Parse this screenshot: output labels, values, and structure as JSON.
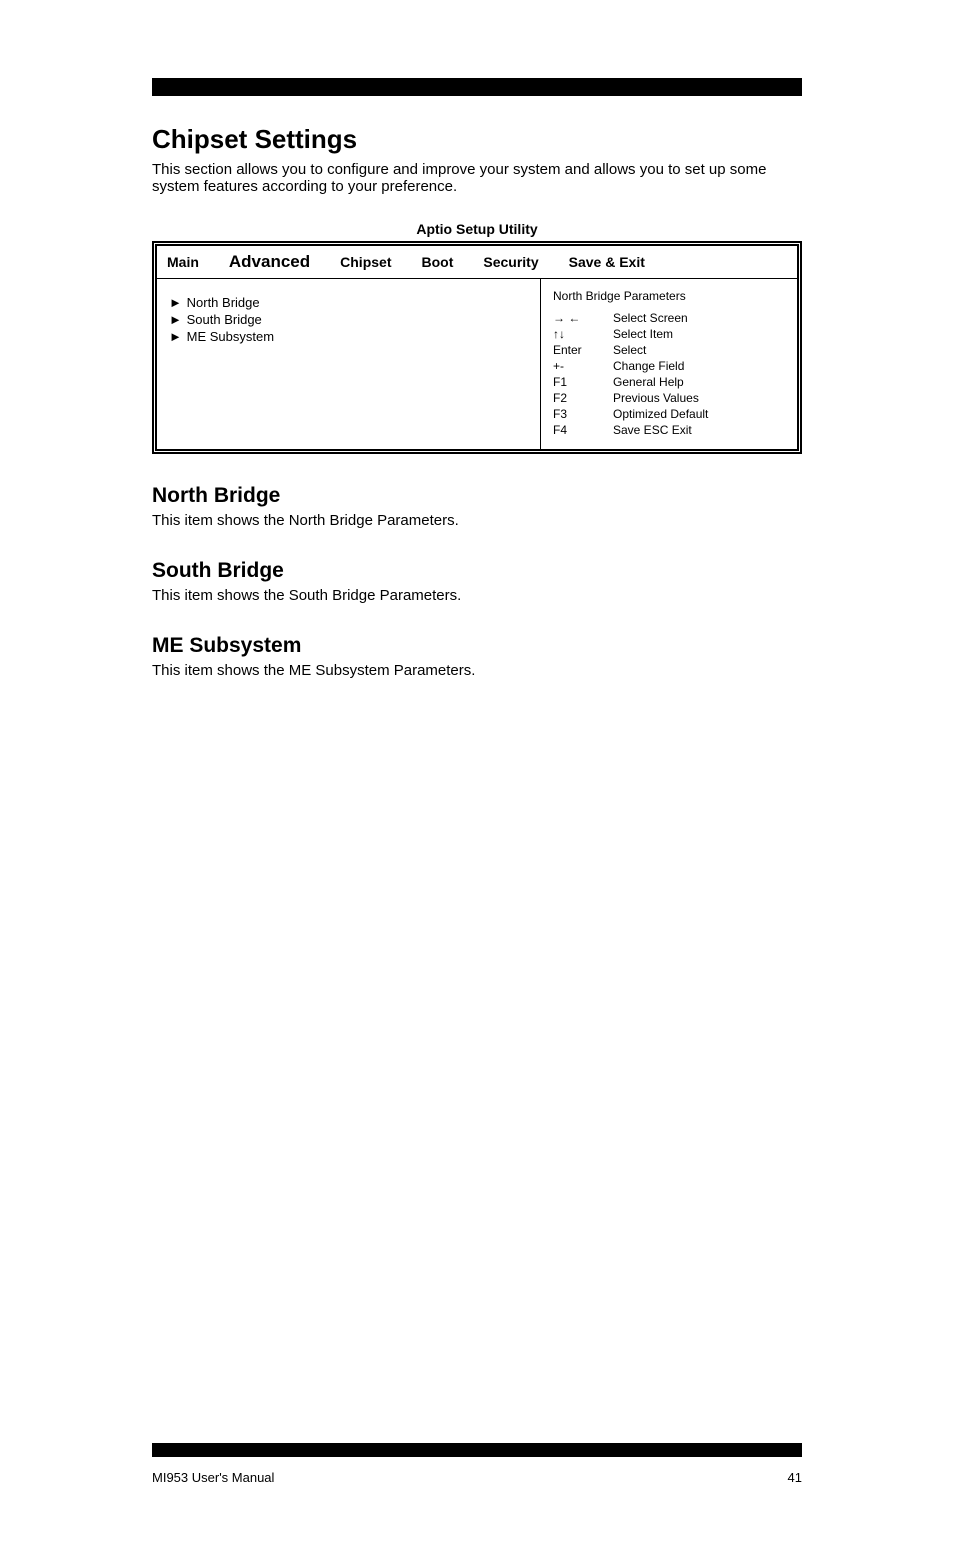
{
  "page": {
    "title": "Chipset Settings",
    "desc": "This section allows you to configure and improve your system and allows you to set up some system features according to your preference."
  },
  "utility_title": "Aptio Setup Utility",
  "tabs": {
    "main": "Main",
    "advanced": "Advanced",
    "chipset": "Chipset",
    "boot": "Boot",
    "security": "Security",
    "save_exit": "Save & Exit"
  },
  "menu": {
    "items": [
      "North Bridge",
      "South Bridge",
      "ME Subsystem"
    ]
  },
  "help": {
    "top": "North Bridge Parameters",
    "lines": [
      {
        "key": "→ ←",
        "desc": "Select Screen"
      },
      {
        "key": "↑↓",
        "desc": "Select Item"
      },
      {
        "key": "Enter",
        "desc": "Select"
      },
      {
        "key": "+-",
        "desc": "Change Field"
      },
      {
        "key": "F1",
        "desc": "General Help"
      },
      {
        "key": "F2",
        "desc": "Previous Values"
      },
      {
        "key": "F3",
        "desc": "Optimized Default"
      },
      {
        "key": "F4",
        "desc": "Save ESC Exit"
      }
    ]
  },
  "sections": {
    "north": {
      "title": "North Bridge",
      "desc": "This item shows the North Bridge Parameters."
    },
    "south": {
      "title": "South Bridge",
      "desc": "This item shows the South Bridge Parameters."
    },
    "me": {
      "title": "ME Subsystem",
      "desc": "This item shows the ME Subsystem Parameters."
    }
  },
  "footer": {
    "left": "MI953 User's Manual",
    "right": "41"
  }
}
